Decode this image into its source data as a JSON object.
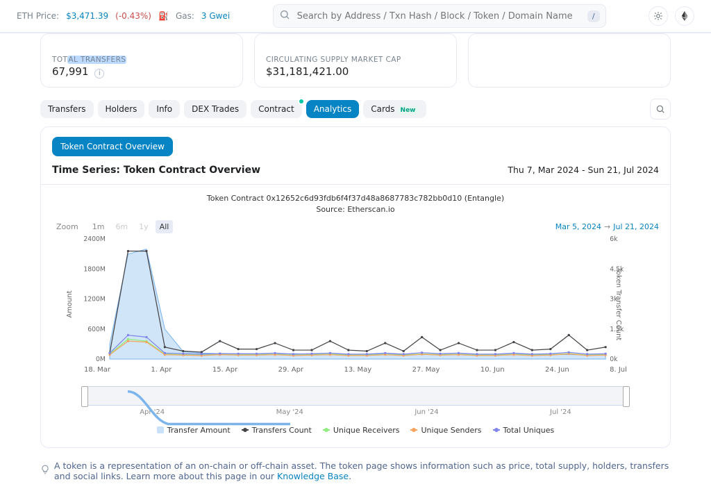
{
  "header": {
    "eth_label": "ETH Price:",
    "eth_price": "$3,471.39",
    "eth_delta": "(-0.43%)",
    "gas_label": "Gas:",
    "gas_value": "3 Gwei",
    "search_placeholder": "Search by Address / Txn Hash / Block / Token / Domain Name",
    "slash_key": "/"
  },
  "stats": {
    "transfers_label_pre": "TOT",
    "transfers_label_hi": "AL TRANSFERS",
    "transfers_value": "67,991",
    "mcap_label": "CIRCULATING SUPPLY MARKET CAP",
    "mcap_value": "$31,181,421.00"
  },
  "tabs": {
    "transfers": "Transfers",
    "holders": "Holders",
    "info": "Info",
    "dex": "DEX Trades",
    "contract": "Contract",
    "analytics": "Analytics",
    "cards": "Cards",
    "new_badge": "New"
  },
  "panel": {
    "btn": "Token Contract Overview",
    "title": "Time Series: Token Contract Overview",
    "date_range": "Thu 7, Mar 2024 - Sun 21, Jul 2024"
  },
  "footer": {
    "text": "A token is a representation of an on-chain or off-chain asset. The token page shows information such as price, total supply, holders, transfers and social links. Learn more about this page in our ",
    "link": "Knowledge Base",
    "period": "."
  },
  "chart_data": {
    "type": "line",
    "title": "Token Contract 0x12652c6d93fdb6f4f37d48a8687783c782bb0d10 (Entangle)",
    "subtitle": "Source: Etherscan.io",
    "zoom": {
      "label": "Zoom",
      "options": [
        "1m",
        "6m",
        "1y",
        "All"
      ],
      "selected": "All"
    },
    "range_picker": {
      "from": "Mar 5, 2024",
      "to": "Jul 21, 2024"
    },
    "y_left": {
      "label": "Amount",
      "min": 0,
      "max": 2400,
      "ticks": [
        0,
        600,
        1200,
        1800,
        2400
      ],
      "unit_suffix": "M"
    },
    "y_right": {
      "label": "Token Transfer Count",
      "min": 0,
      "max": 6,
      "ticks": [
        0,
        1.5,
        3,
        4.5,
        6
      ],
      "unit_suffix": "k"
    },
    "x": {
      "ticks": [
        "18. Mar",
        "1. Apr",
        "15. Apr",
        "29. Apr",
        "13. May",
        "27. May",
        "10. Jun",
        "24. Jun",
        "8. Jul"
      ]
    },
    "navigator_ticks": [
      "Apr '24",
      "May '24",
      "Jun '24",
      "Jul '24"
    ],
    "series": [
      {
        "name": "Transfer Amount",
        "type": "area",
        "axis": "left_M",
        "color": "#7cb5ec",
        "values": [
          300,
          2100,
          2200,
          600,
          150,
          120,
          110,
          110,
          100,
          100,
          110,
          100,
          100,
          90,
          100,
          100,
          95,
          90,
          95,
          100,
          90,
          90,
          100,
          95,
          95,
          90,
          85,
          90
        ]
      },
      {
        "name": "Transfers Count",
        "type": "line",
        "axis": "right_k",
        "color": "#434348",
        "values": [
          0.3,
          5.4,
          5.4,
          0.6,
          0.4,
          0.35,
          0.9,
          0.5,
          0.5,
          0.8,
          0.45,
          0.45,
          0.9,
          0.45,
          0.4,
          0.8,
          0.4,
          1.1,
          0.45,
          0.8,
          0.45,
          0.45,
          0.85,
          0.45,
          0.5,
          1.2,
          0.45,
          0.6
        ]
      },
      {
        "name": "Unique Receivers",
        "type": "line",
        "axis": "right_k",
        "color": "#90ed7d",
        "values": [
          0.25,
          1.0,
          0.9,
          0.25,
          0.22,
          0.2,
          0.25,
          0.22,
          0.22,
          0.24,
          0.2,
          0.22,
          0.25,
          0.2,
          0.2,
          0.24,
          0.2,
          0.26,
          0.22,
          0.24,
          0.2,
          0.2,
          0.24,
          0.2,
          0.22,
          0.28,
          0.2,
          0.22
        ]
      },
      {
        "name": "Unique Senders",
        "type": "line",
        "axis": "right_k",
        "color": "#f7a35c",
        "values": [
          0.22,
          0.9,
          0.85,
          0.22,
          0.2,
          0.18,
          0.22,
          0.2,
          0.2,
          0.22,
          0.18,
          0.2,
          0.22,
          0.18,
          0.18,
          0.22,
          0.18,
          0.24,
          0.2,
          0.22,
          0.18,
          0.18,
          0.22,
          0.18,
          0.2,
          0.26,
          0.18,
          0.2
        ]
      },
      {
        "name": "Total Uniques",
        "type": "line",
        "axis": "right_k",
        "color": "#8085e9",
        "values": [
          0.3,
          1.2,
          1.1,
          0.3,
          0.27,
          0.25,
          0.28,
          0.27,
          0.27,
          0.3,
          0.25,
          0.27,
          0.3,
          0.25,
          0.25,
          0.3,
          0.25,
          0.32,
          0.27,
          0.3,
          0.25,
          0.25,
          0.3,
          0.25,
          0.27,
          0.34,
          0.25,
          0.27
        ]
      }
    ]
  }
}
